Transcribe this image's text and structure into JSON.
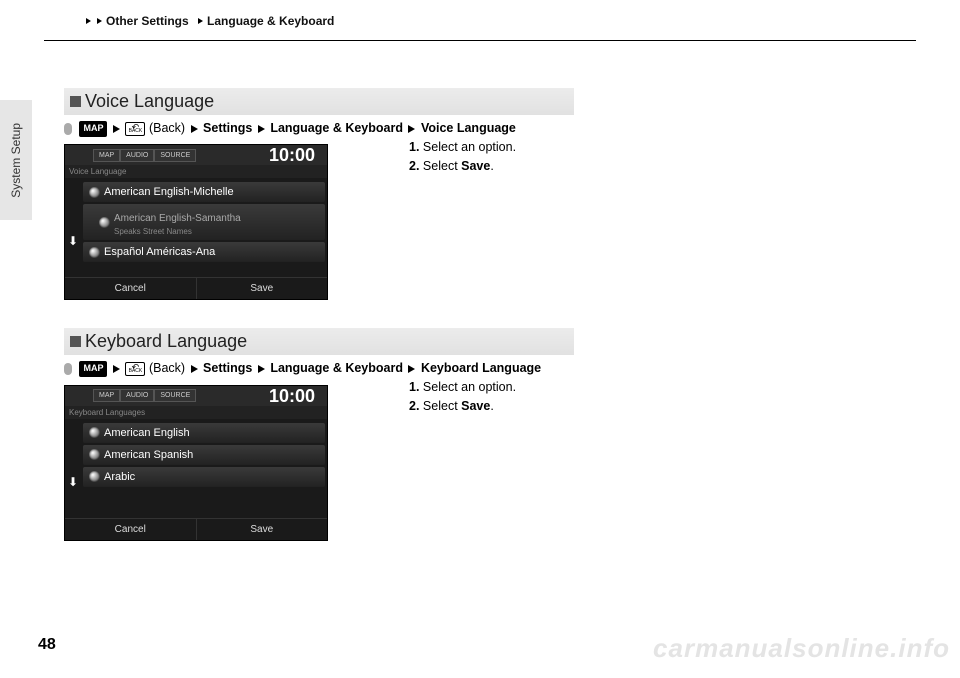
{
  "breadcrumb": {
    "seg1": "Other Settings",
    "seg2": "Language & Keyboard"
  },
  "side_tab": "System Setup",
  "sections": [
    {
      "title": "Voice Language",
      "path": {
        "map": "MAP",
        "back": "(Back)",
        "settings": "Settings",
        "lk": "Language & Keyboard",
        "last": "Voice Language"
      },
      "screenshot": {
        "tabs": [
          "MAP",
          "AUDIO",
          "SOURCE"
        ],
        "clock": "10:00",
        "subtitle": "Voice Language",
        "options": [
          {
            "text": "American English-Michelle"
          },
          {
            "text": "American English-Samantha",
            "sub": "Speaks Street Names"
          },
          {
            "text": "Español Américas-Ana"
          }
        ],
        "cancel": "Cancel",
        "save": "Save"
      },
      "instr": {
        "s1n": "1.",
        "s1t": "Select an option.",
        "s2n": "2.",
        "s2t1": "Select ",
        "s2b": "Save",
        "s2t2": "."
      }
    },
    {
      "title": "Keyboard Language",
      "path": {
        "map": "MAP",
        "back": "(Back)",
        "settings": "Settings",
        "lk": "Language & Keyboard",
        "last": "Keyboard Language"
      },
      "screenshot": {
        "tabs": [
          "MAP",
          "AUDIO",
          "SOURCE"
        ],
        "clock": "10:00",
        "subtitle": "Keyboard Languages",
        "options": [
          {
            "text": "American English"
          },
          {
            "text": "American Spanish"
          },
          {
            "text": "Arabic"
          }
        ],
        "cancel": "Cancel",
        "save": "Save"
      },
      "instr": {
        "s1n": "1.",
        "s1t": "Select an option.",
        "s2n": "2.",
        "s2t1": "Select ",
        "s2b": "Save",
        "s2t2": "."
      }
    }
  ],
  "page_number": "48",
  "watermark": "carmanualsonline.info"
}
